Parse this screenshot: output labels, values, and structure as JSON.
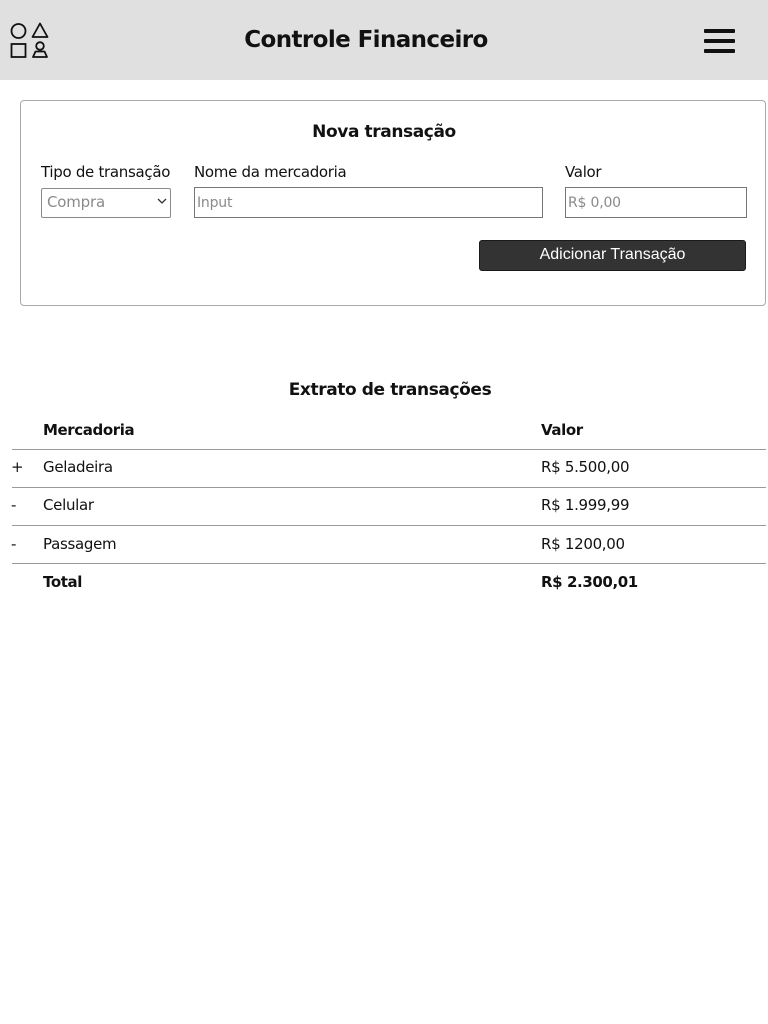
{
  "header": {
    "title": "Controle Financeiro",
    "logo_icon": "shapes-icon",
    "menu_icon": "hamburger-menu-icon"
  },
  "form": {
    "title": "Nova transação",
    "type_label": "Tipo de transação",
    "type_value": "Compra",
    "name_label": "Nome da mercadoria",
    "name_placeholder": "Input",
    "value_label": "Valor",
    "value_placeholder": "R$ 0,00",
    "submit_label": "Adicionar Transação"
  },
  "statement": {
    "title": "Extrato de transações",
    "col_item": "Mercadoria",
    "col_value": "Valor",
    "rows": [
      {
        "sign": "+",
        "item": "Geladeira",
        "value": "R$ 5.500,00"
      },
      {
        "sign": "-",
        "item": "Celular",
        "value": "R$ 1.999,99"
      },
      {
        "sign": "-",
        "item": "Passagem",
        "value": "R$ 1200,00"
      }
    ],
    "total_label": "Total",
    "total_value": "R$ 2.300,01"
  },
  "colors": {
    "header_bg": "#e0e0e0",
    "button_bg": "#333333",
    "button_text": "#ffffff"
  }
}
